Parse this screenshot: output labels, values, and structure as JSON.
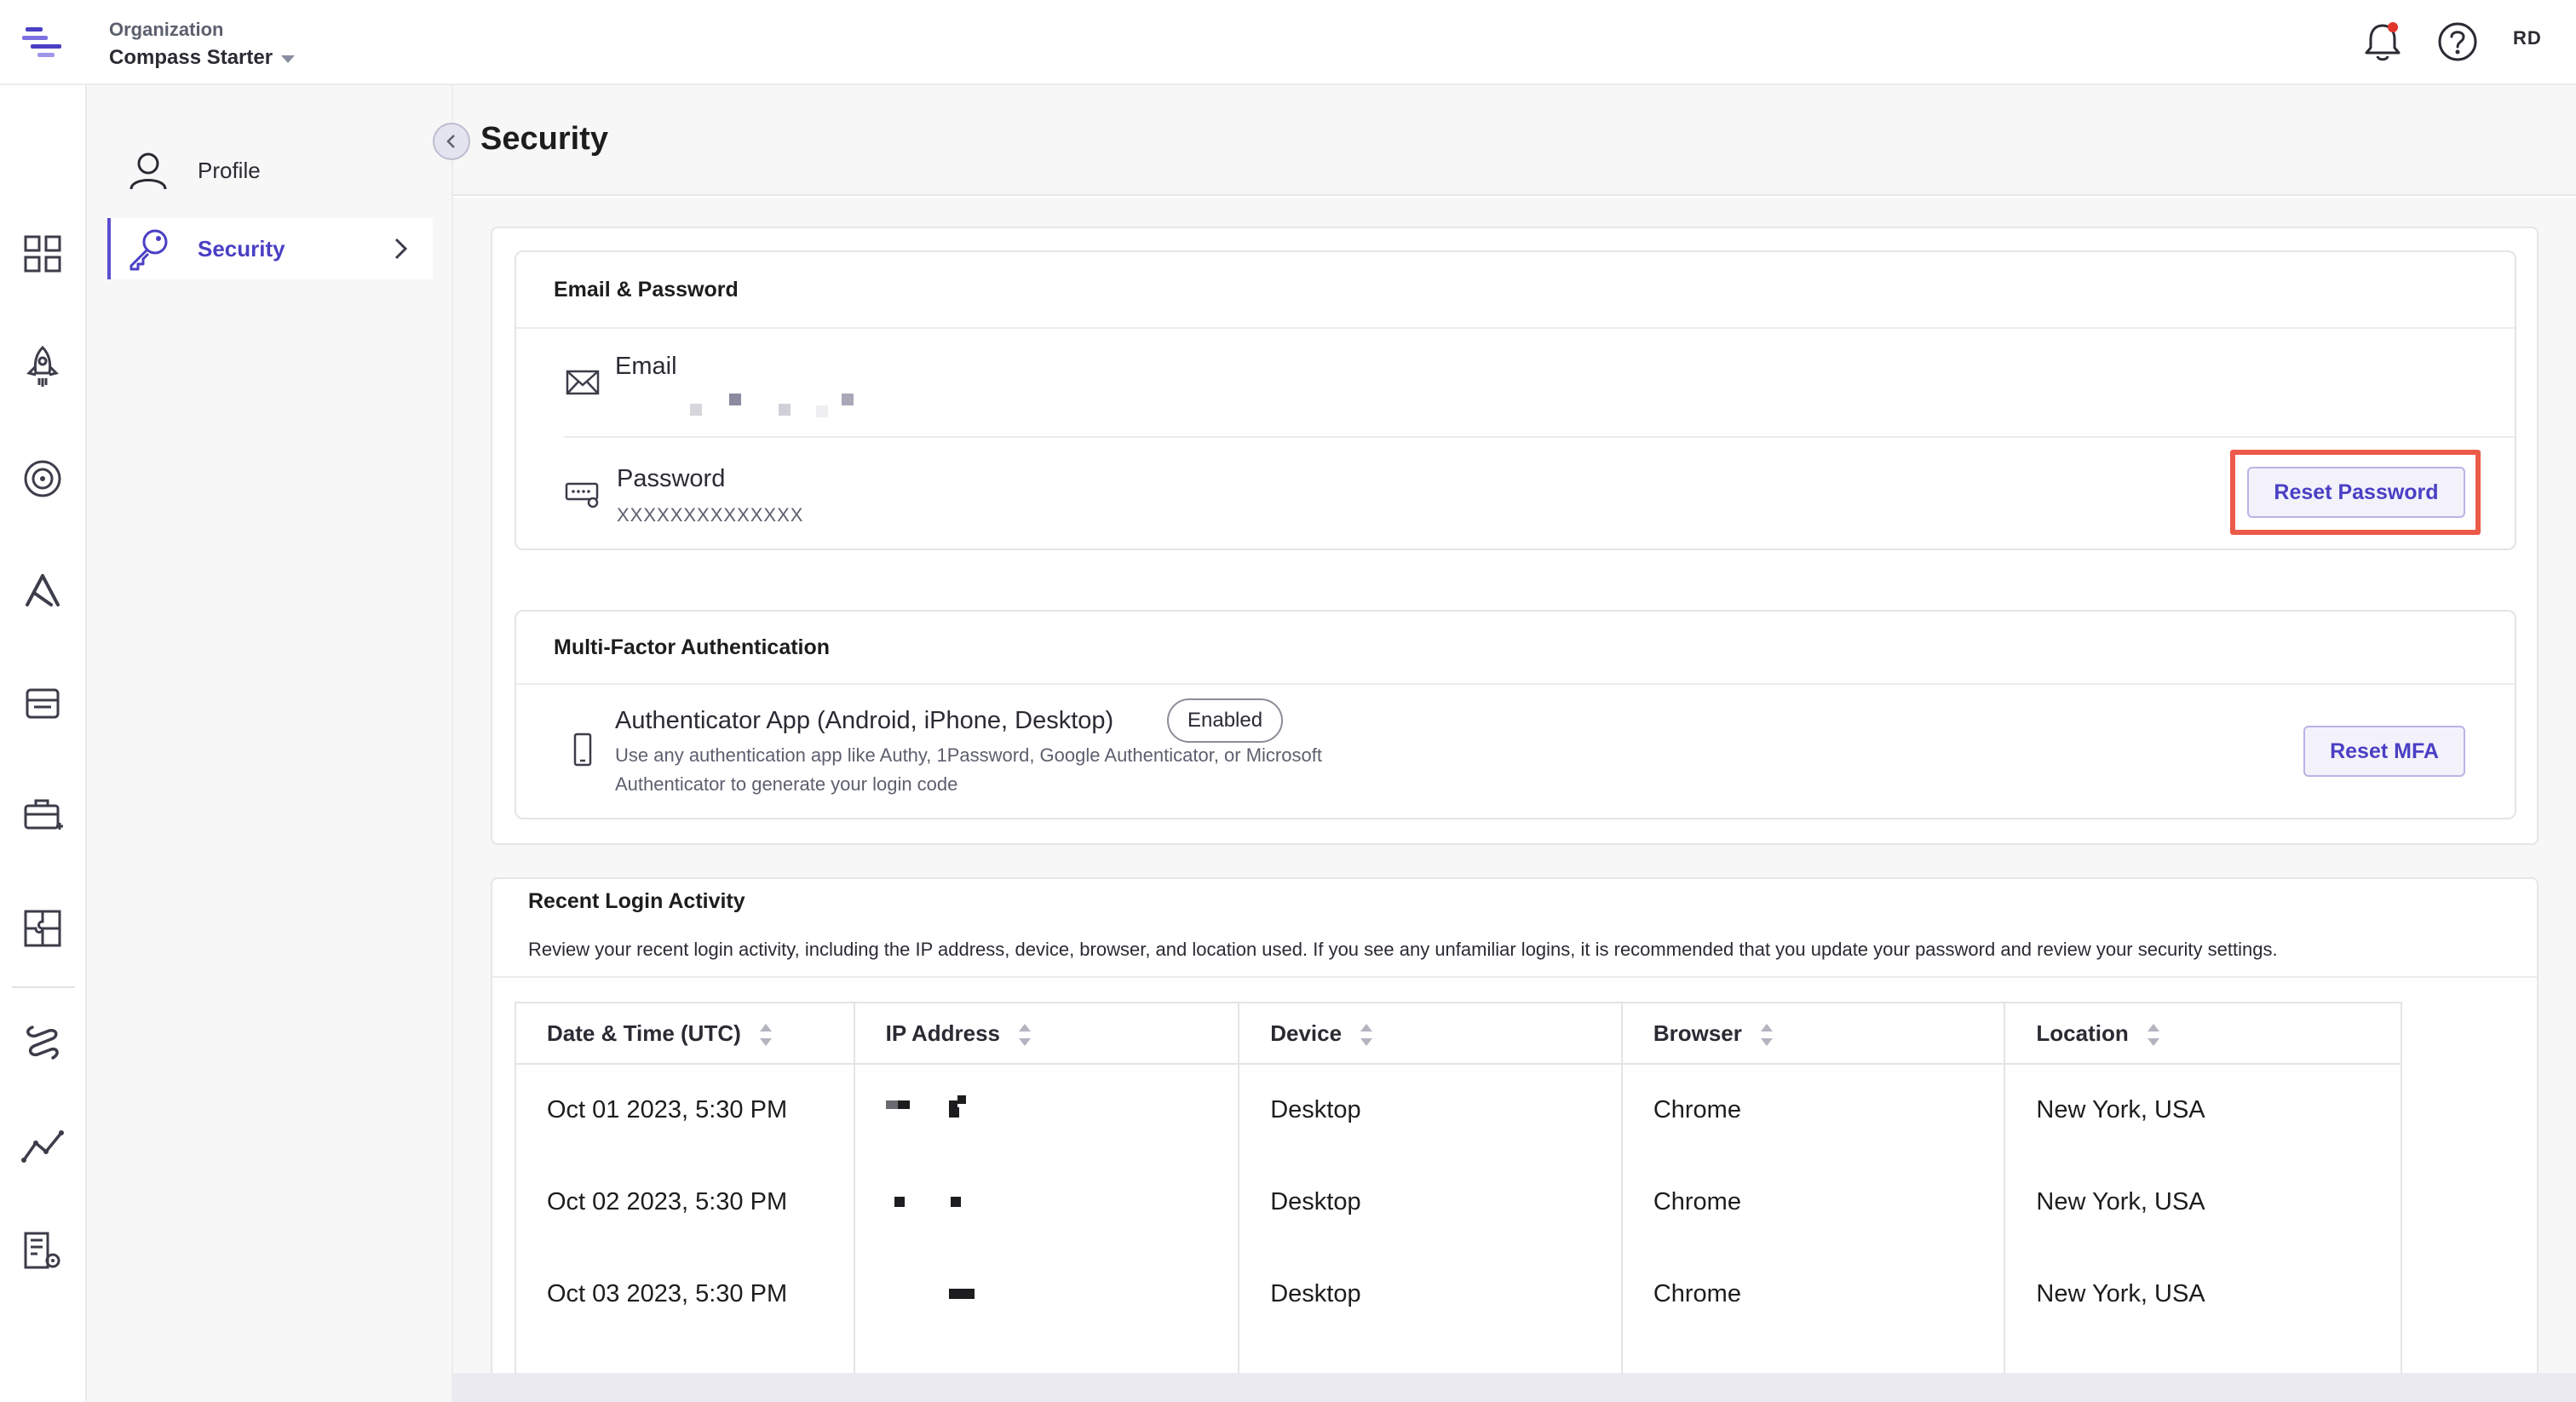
{
  "header": {
    "org_label": "Organization",
    "org_name": "Compass Starter",
    "user_initials": "RD",
    "notification_dot_color": "#e0352b"
  },
  "rail": {
    "icons": [
      "dashboard-icon",
      "rocket-icon",
      "target-icon",
      "triangle-nodes-icon",
      "store-icon",
      "toolbox-icon",
      "puzzle-icon",
      "chain-link-icon",
      "line-chart-icon",
      "building-settings-icon"
    ]
  },
  "subnav": {
    "items": [
      {
        "label": "Profile",
        "icon": "user-icon",
        "active": false
      },
      {
        "label": "Security",
        "icon": "key-icon",
        "active": true
      }
    ]
  },
  "page": {
    "title": "Security"
  },
  "email_password": {
    "title": "Email & Password",
    "email_label": "Email",
    "password_label": "Password",
    "password_value": "XXXXXXXXXXXXXX",
    "reset_password_label": "Reset Password"
  },
  "mfa": {
    "title": "Multi-Factor Authentication",
    "app_label": "Authenticator App (Android, iPhone, Desktop)",
    "status": "Enabled",
    "description": "Use any authentication app like Authy, 1Password, Google Authenticator, or Microsoft Authenticator to generate your login code",
    "reset_label": "Reset MFA"
  },
  "login_activity": {
    "title": "Recent Login Activity",
    "description": "Review your recent login activity, including the IP address, device, browser, and location used. If you see any unfamiliar logins, it is recommended that you update your password and review your security settings.",
    "columns": [
      "Date & Time (UTC)",
      "IP Address",
      "Device",
      "Browser",
      "Location"
    ],
    "rows": [
      {
        "datetime": "Oct 01 2023, 5:30 PM",
        "device": "Desktop",
        "browser": "Chrome",
        "location": "New York, USA"
      },
      {
        "datetime": "Oct 02 2023, 5:30 PM",
        "device": "Desktop",
        "browser": "Chrome",
        "location": "New York, USA"
      },
      {
        "datetime": "Oct 03 2023, 5:30 PM",
        "device": "Desktop",
        "browser": "Chrome",
        "location": "New York, USA"
      }
    ]
  },
  "colors": {
    "accent": "#4a3fc4",
    "highlight": "#ec5b4a"
  }
}
